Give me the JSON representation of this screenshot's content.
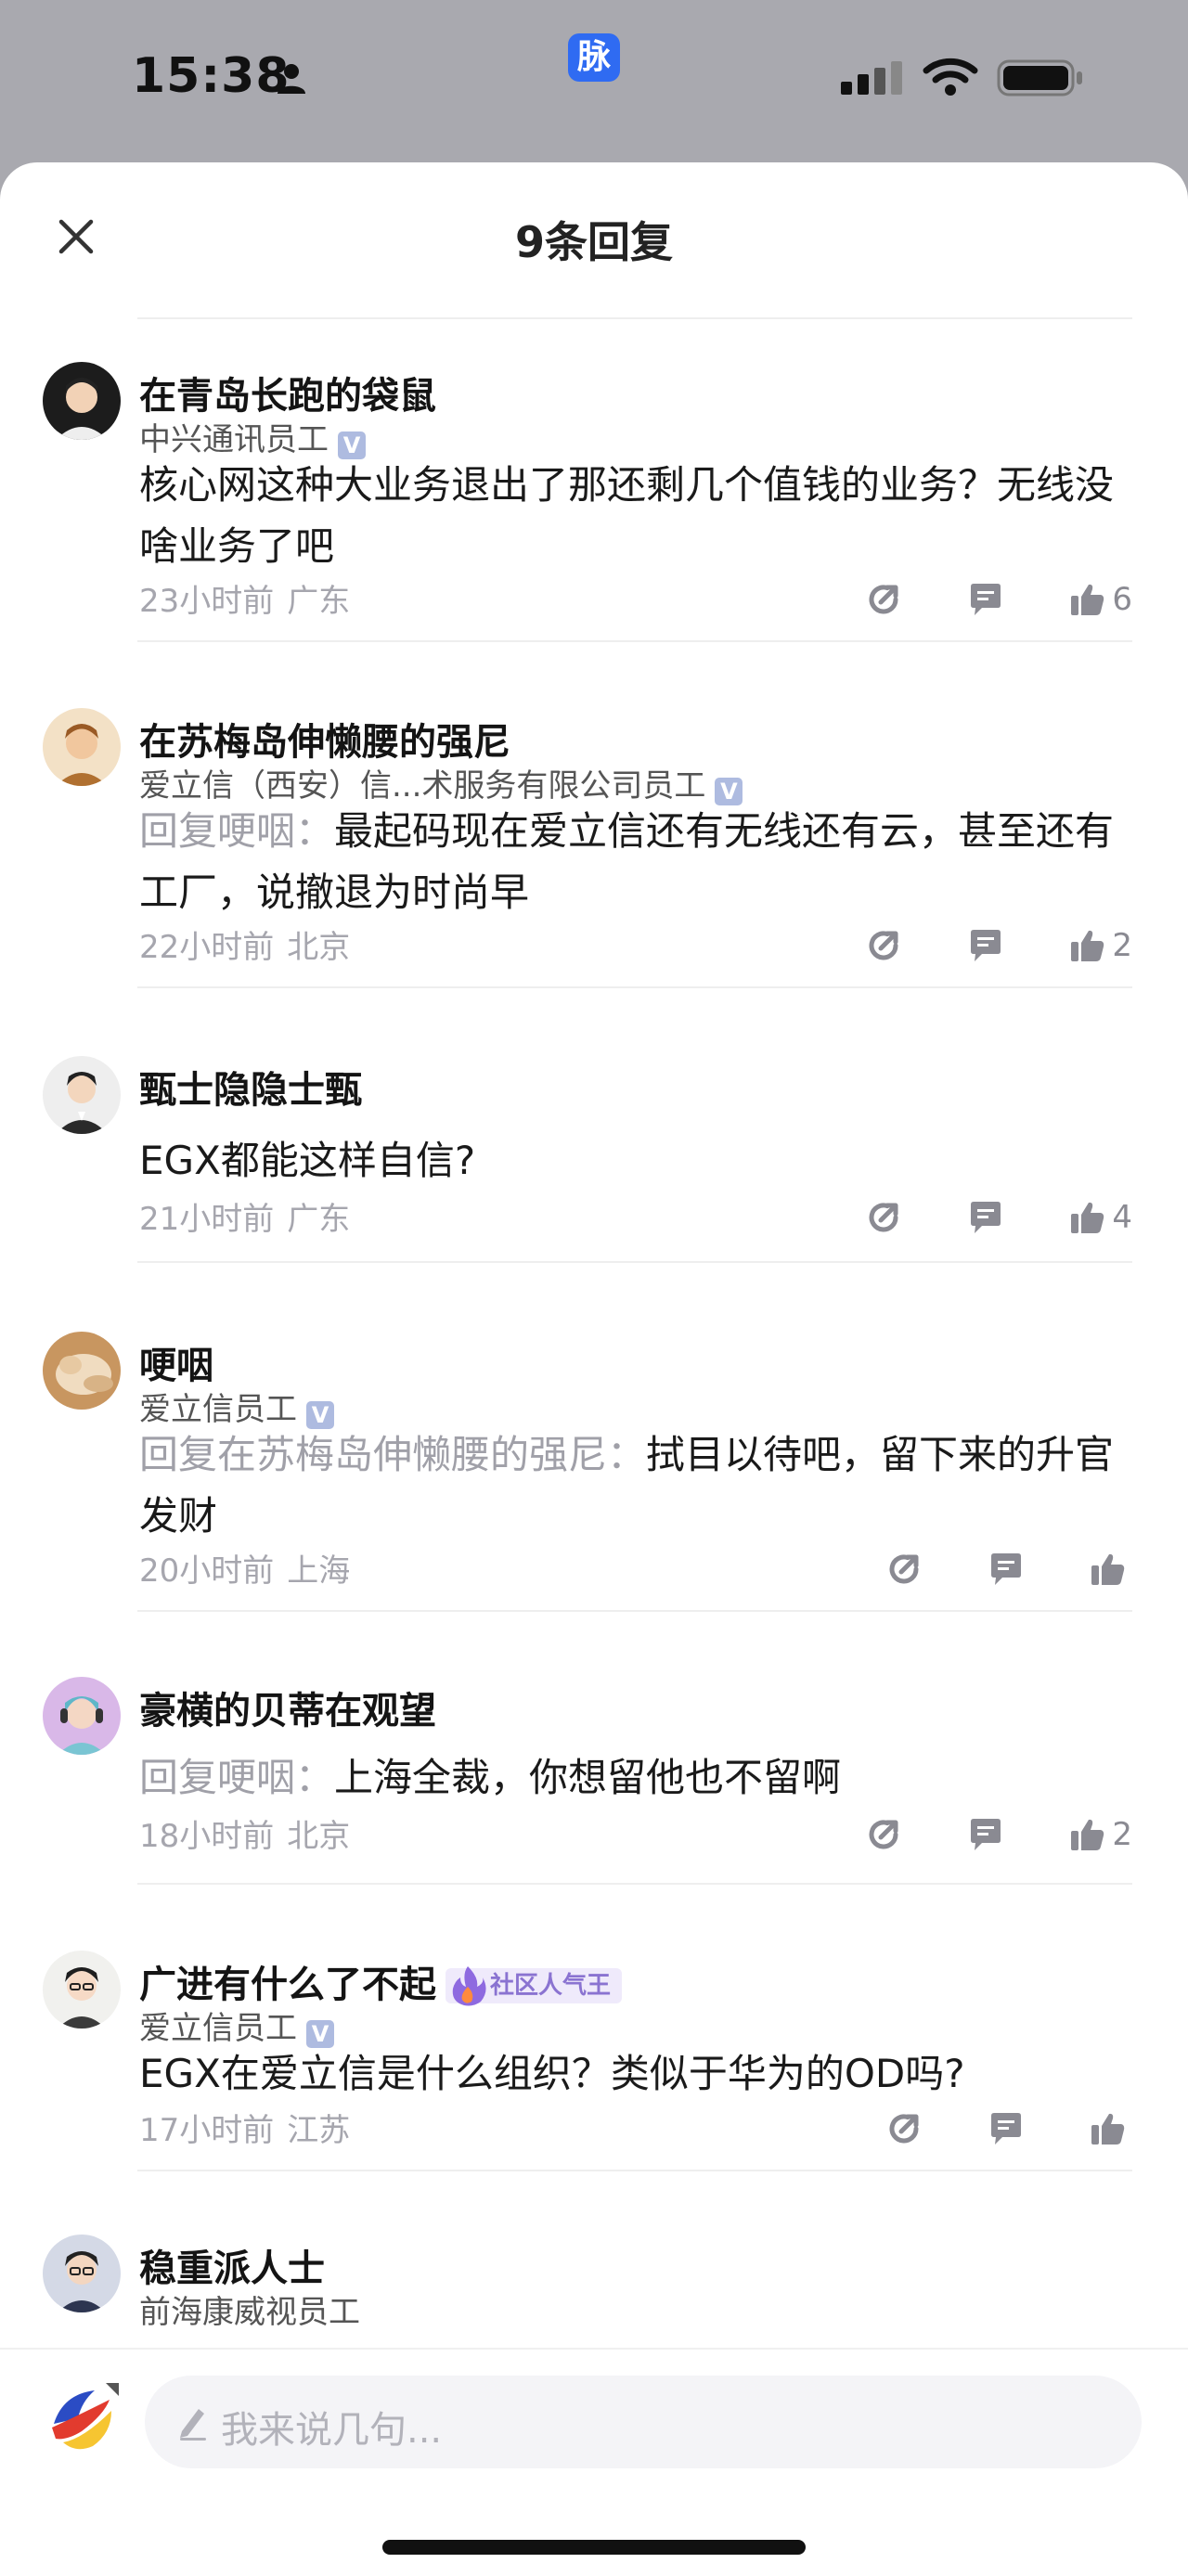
{
  "status_bar": {
    "time": "15:38",
    "app_badge": "脉"
  },
  "sheet": {
    "title": "9条回复"
  },
  "replies": [
    {
      "name": "在青岛长跑的袋鼠",
      "company": "中兴通讯员工",
      "verified": true,
      "reply_to": "",
      "text": "核心网这种大业务退出了那还剩几个值钱的业务？无线没啥业务了吧",
      "time": "23小时前",
      "location": "广东",
      "likes": "6"
    },
    {
      "name": "在苏梅岛伸懒腰的强尼",
      "company": "爱立信（西安）信...术服务有限公司员工",
      "verified": true,
      "reply_to": "回复哽咽：",
      "text": "最起码现在爱立信还有无线还有云，甚至还有工厂，说撤退为时尚早",
      "time": "22小时前",
      "location": "北京",
      "likes": "2"
    },
    {
      "name": "甄士隐隐士甄",
      "company": "",
      "verified": false,
      "reply_to": "",
      "text": "EGX都能这样自信?",
      "time": "21小时前",
      "location": "广东",
      "likes": "4"
    },
    {
      "name": "哽咽",
      "company": "爱立信员工",
      "verified": true,
      "reply_to": "回复在苏梅岛伸懒腰的强尼：",
      "text": "拭目以待吧，留下来的升官发财",
      "time": "20小时前",
      "location": "上海",
      "likes": ""
    },
    {
      "name": "豪横的贝蒂在观望",
      "company": "",
      "verified": false,
      "reply_to": "回复哽咽：",
      "text": "上海全裁，你想留他也不留啊",
      "time": "18小时前",
      "location": "北京",
      "likes": "2"
    },
    {
      "name": "广进有什么了不起",
      "company": "爱立信员工",
      "verified": true,
      "badge": "社区人气王",
      "reply_to": "",
      "text": "EGX在爱立信是什么组织？类似于华为的OD吗?",
      "time": "17小时前",
      "location": "江苏",
      "likes": ""
    },
    {
      "name": "稳重派人士",
      "company": "前海康威视员工",
      "verified": false,
      "reply_to": "",
      "text": "",
      "time": "",
      "location": "",
      "likes": ""
    }
  ],
  "input": {
    "placeholder": "我来说几句..."
  },
  "colors": {
    "accent": "#2f6bf2",
    "muted": "#a6a6ae",
    "icon": "#8a8a92",
    "verified": "#aebbe0"
  }
}
